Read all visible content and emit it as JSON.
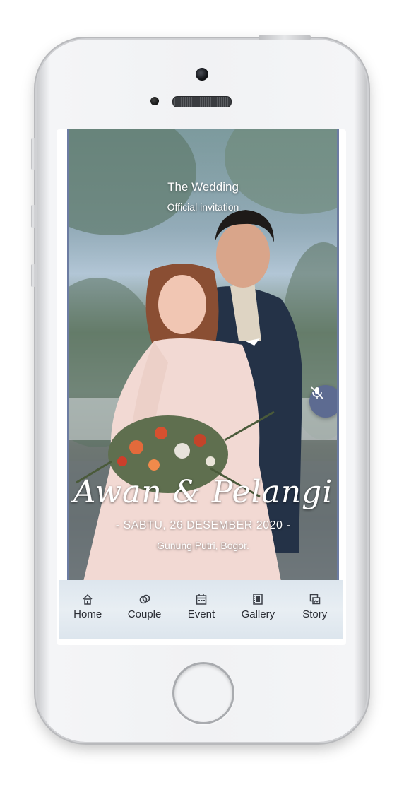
{
  "hero": {
    "title": "The Wedding",
    "subtitle": "Official invitation",
    "couple_names": "Awan & Pelangi",
    "date": "- SABTU, 26 DESEMBER 2020 -",
    "location": "Gunung Putri, Bogor."
  },
  "controls": {
    "mute_icon": "muted-microphone-icon"
  },
  "nav": {
    "items": [
      {
        "label": "Home",
        "icon": "home-icon"
      },
      {
        "label": "Couple",
        "icon": "rings-icon"
      },
      {
        "label": "Event",
        "icon": "calendar-icon"
      },
      {
        "label": "Gallery",
        "icon": "film-icon"
      },
      {
        "label": "Story",
        "icon": "photos-icon"
      }
    ]
  },
  "colors": {
    "accent": "#5d6b91",
    "nav_background": "#e3eaf0"
  }
}
